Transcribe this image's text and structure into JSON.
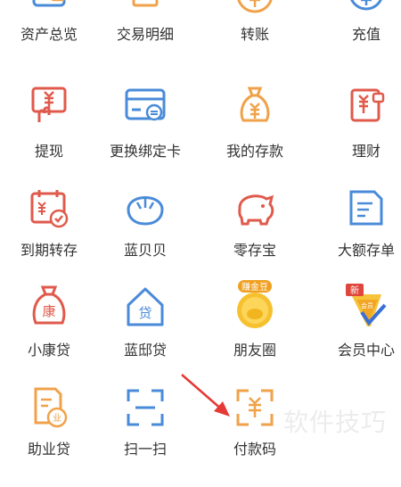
{
  "grid": {
    "items": [
      {
        "label": "资产总览",
        "icon": "wallet-icon"
      },
      {
        "label": "交易明细",
        "icon": "receipt-list-icon"
      },
      {
        "label": "转账",
        "icon": "transfer-yuan-icon"
      },
      {
        "label": "充值",
        "icon": "recharge-yuan-icon"
      },
      {
        "label": "提现",
        "icon": "withdraw-hand-icon"
      },
      {
        "label": "更换绑定卡",
        "icon": "bank-card-icon"
      },
      {
        "label": "我的存款",
        "icon": "money-bag-icon"
      },
      {
        "label": "理财",
        "icon": "wealth-management-icon"
      },
      {
        "label": "到期转存",
        "icon": "calendar-renew-icon"
      },
      {
        "label": "蓝贝贝",
        "icon": "shell-icon"
      },
      {
        "label": "零存宝",
        "icon": "piggy-bank-icon"
      },
      {
        "label": "大额存单",
        "icon": "large-deposit-certificate-icon"
      },
      {
        "label": "小康贷",
        "icon": "loan-bag-icon",
        "icon_text": "康"
      },
      {
        "label": "蓝邸贷",
        "icon": "house-loan-icon",
        "icon_text": "贷"
      },
      {
        "label": "朋友圈",
        "icon": "gold-bean-icon",
        "icon_text": "赚金豆"
      },
      {
        "label": "会员中心",
        "icon": "vip-badge-icon",
        "icon_text": "新",
        "icon_subtext": "会员"
      },
      {
        "label": "助业贷",
        "icon": "business-loan-icon",
        "icon_text": "业"
      },
      {
        "label": "扫一扫",
        "icon": "scan-icon"
      },
      {
        "label": "付款码",
        "icon": "payment-code-icon"
      }
    ]
  },
  "watermark": "软件技巧",
  "colors": {
    "blue": "#4a8bd9",
    "orange": "#f0a24a",
    "red": "#e05a4c",
    "gold": "#f2b51f",
    "text": "#333333"
  }
}
